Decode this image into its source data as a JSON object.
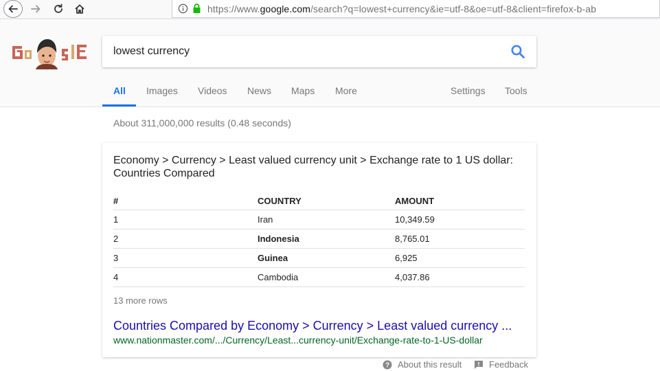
{
  "browser": {
    "url": "https://www.google.com/search?q=lowest+currency&ie=utf-8&oe=utf-8&client=firefox-b-ab",
    "url_prefix": "https://www.",
    "url_domain": "google.com",
    "url_suffix": "/search?q=lowest+currency&ie=utf-8&oe=utf-8&client=firefox-b-ab",
    "icons": [
      "back-icon",
      "forward-icon",
      "reload-icon",
      "home-icon",
      "info-icon",
      "lock-icon"
    ]
  },
  "search": {
    "query": "lowest currency"
  },
  "tabs": [
    {
      "label": "All",
      "active": true
    },
    {
      "label": "Images"
    },
    {
      "label": "Videos"
    },
    {
      "label": "News"
    },
    {
      "label": "Maps"
    },
    {
      "label": "More"
    },
    {
      "label": "Settings"
    },
    {
      "label": "Tools"
    }
  ],
  "results_stats": "About 311,000,000 results (0.48 seconds)",
  "card": {
    "title": "Economy > Currency > Least valued currency unit > Exchange rate to 1 US dollar: Countries Compared",
    "headers": [
      "#",
      "COUNTRY",
      "AMOUNT"
    ],
    "rows": [
      {
        "rank": "1",
        "country": "Iran",
        "amount": "10,349.59",
        "bold": false
      },
      {
        "rank": "2",
        "country": "Indonesia",
        "amount": "8,765.01",
        "bold": true
      },
      {
        "rank": "3",
        "country": "Guinea",
        "amount": "6,925",
        "bold": true
      },
      {
        "rank": "4",
        "country": "Cambodia",
        "amount": "4,037.86",
        "bold": false
      }
    ],
    "more_rows": "13 more rows",
    "link_title": "Countries Compared by Economy > Currency > Least valued currency ...",
    "link_url": "www.nationmaster.com/.../Currency/Least...currency-unit/Exchange-rate-to-1-US-dollar"
  },
  "footer": {
    "about": "About this result",
    "feedback": "Feedback"
  },
  "colors": {
    "link": "#1a0dab",
    "url_green": "#006621",
    "accent_blue": "#1a73e8",
    "lock_green": "#12bc00"
  }
}
